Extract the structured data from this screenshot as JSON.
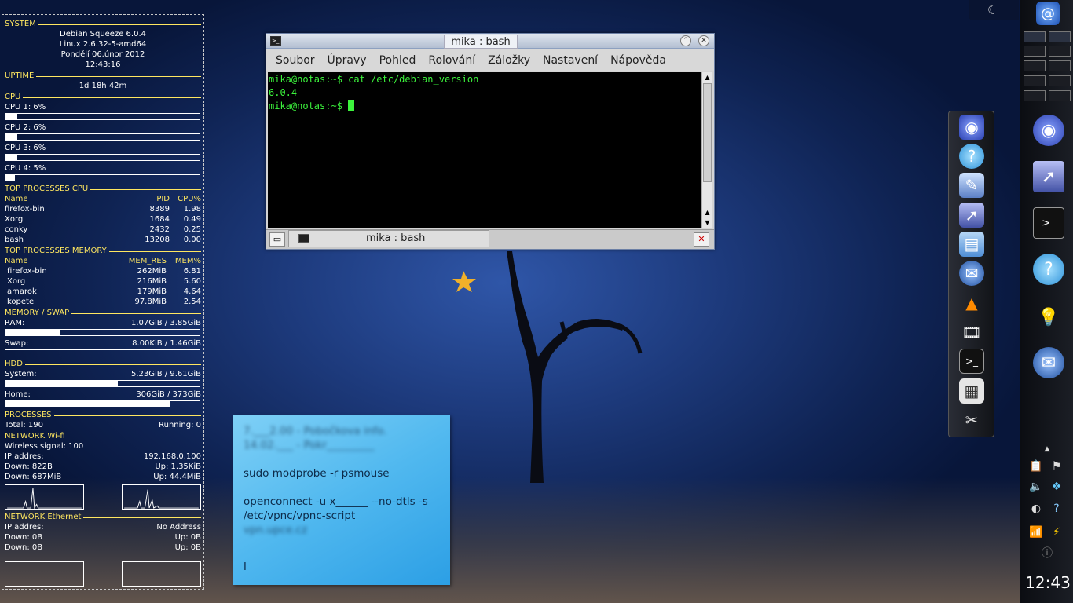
{
  "conky": {
    "system": {
      "title": "SYSTEM",
      "os": "Debian Squeeze 6.0.4",
      "kernel": "Linux 2.6.32-5-amd64",
      "date": "Pondělí 06.únor 2012",
      "time": "12:43:16"
    },
    "uptime": {
      "title": "UPTIME",
      "value": "1d 18h 42m"
    },
    "cpu": {
      "title": "CPU",
      "cores": [
        {
          "label": "CPU 1: 6%",
          "percent": 6
        },
        {
          "label": "CPU 2: 6%",
          "percent": 6
        },
        {
          "label": "CPU 3: 6%",
          "percent": 6
        },
        {
          "label": "CPU 4: 5%",
          "percent": 5
        }
      ]
    },
    "top_cpu": {
      "title": "TOP PROCESSES CPU",
      "headers": [
        "Name",
        "PID",
        "CPU%"
      ],
      "rows": [
        [
          "firefox-bin",
          "8389",
          "1.98"
        ],
        [
          "Xorg",
          "1684",
          "0.49"
        ],
        [
          "conky",
          "2432",
          "0.25"
        ],
        [
          "bash",
          "13208",
          "0.00"
        ]
      ]
    },
    "top_mem": {
      "title": "TOP PROCESSES MEMORY",
      "headers": [
        "Name",
        "MEM_RES",
        "MEM%"
      ],
      "rows": [
        [
          "firefox-bin",
          "262MiB",
          "6.81"
        ],
        [
          "Xorg",
          "216MiB",
          "5.60"
        ],
        [
          "amarok",
          "179MiB",
          "4.64"
        ],
        [
          "kopete",
          "97.8MiB",
          "2.54"
        ]
      ]
    },
    "memory": {
      "title": "MEMORY / SWAP",
      "ram_label": "RAM:",
      "ram_value": "1.07GiB / 3.85GiB",
      "ram_percent": 28,
      "swap_label": "Swap:",
      "swap_value": "8.00KiB / 1.46GiB",
      "swap_percent": 0
    },
    "hdd": {
      "title": "HDD",
      "system_label": "System:",
      "system_value": "5.23GiB / 9.61GiB",
      "system_percent": 58,
      "home_label": "Home:",
      "home_value": "306GiB  / 373GiB",
      "home_percent": 85
    },
    "processes": {
      "title": "PROCESSES",
      "total": "Total: 190",
      "running": "Running: 0"
    },
    "wifi": {
      "title": "NETWORK Wi-fi",
      "signal": "Wireless signal: 100",
      "ip_label": "IP addres:",
      "ip": "192.168.0.100",
      "down_rate": "Down:  822B",
      "up_rate": "Up:  1.35KiB",
      "down_total": "Down:  687MiB",
      "up_total": "Up:  44.4MiB"
    },
    "ethernet": {
      "title": "NETWORK Ethernet",
      "ip_label": "IP addres:",
      "ip": "No Address",
      "down_rate": "Down:  0B",
      "up_rate": "Up:  0B",
      "down_total": "Down:  0B",
      "up_total": "Up:  0B"
    }
  },
  "terminal": {
    "title": "mika : bash",
    "menu": [
      "Soubor",
      "Úpravy",
      "Pohled",
      "Rolování",
      "Záložky",
      "Nastavení",
      "Nápověda"
    ],
    "lines": [
      "mika@notas:~$ cat /etc/debian_version",
      "6.0.4",
      "mika@notas:~$ "
    ],
    "tab_label": "mika : bash"
  },
  "note": {
    "line1": "7.___2.00 - Pobočkova info.",
    "line2": "14.02.___ - Pokr_________",
    "cmd1": "sudo modprobe -r psmouse",
    "cmd2": "openconnect -u x______ --no-dtls -s /etc/vpnc/vpnc-script",
    "cmd3": "vpn.upce.cz"
  },
  "dock_icons": [
    "kopete-icon",
    "chat-icon",
    "image-editor-icon",
    "window-manager-icon",
    "file-manager-icon",
    "thunderbird-icon",
    "vlc-icon",
    "video-editor-icon",
    "terminal-icon",
    "calculator-icon",
    "settings-tools-icon"
  ],
  "panel": {
    "clock": "12:43"
  },
  "colors": {
    "accent": "#ffe760",
    "terminal_text": "#3cf23c",
    "note": "#50b8ef"
  }
}
